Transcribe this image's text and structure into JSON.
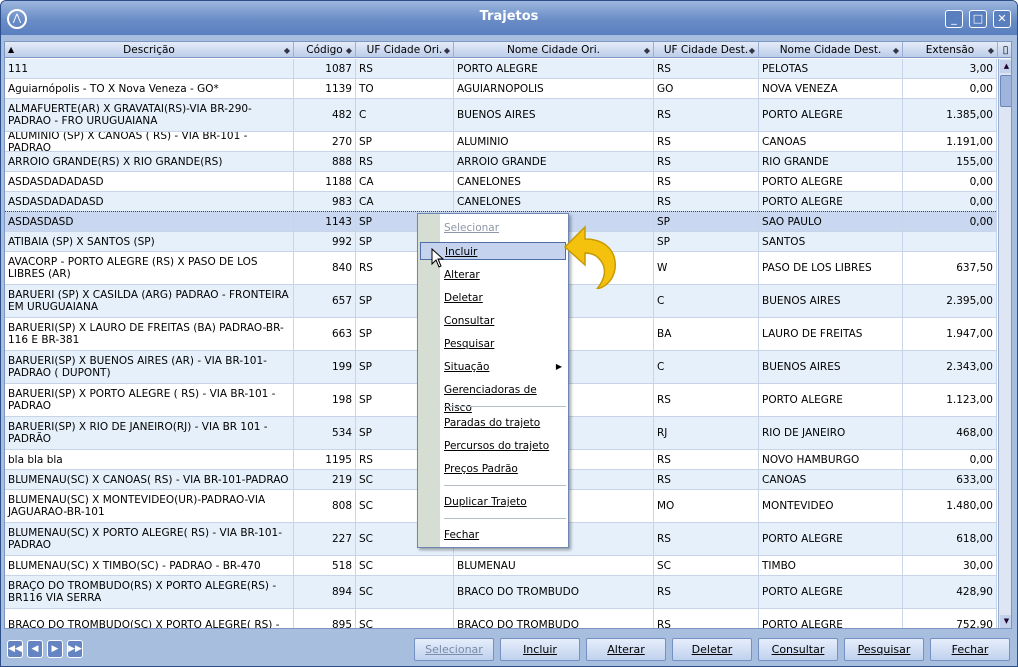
{
  "window": {
    "title": "Trajetos",
    "icons": {
      "logo": "app-logo-icon",
      "minimize": "minimize-icon",
      "maximize": "maximize-icon",
      "close": "close-icon"
    }
  },
  "grid": {
    "headers": [
      "Descrição",
      "Código",
      "UF Cidade Ori.",
      "Nome Cidade Ori.",
      "UF Cidade Dest.",
      "Nome Cidade Dest.",
      "Extensão"
    ],
    "rows": [
      {
        "desc": "111",
        "code": "1087",
        "uf_ori": "RS",
        "city_ori": "PORTO ALEGRE",
        "uf_dest": "RS",
        "city_dest": "PELOTAS",
        "ext": "3,00"
      },
      {
        "desc": "Aguiarnópolis - TO X Nova Veneza - GO*",
        "code": "1139",
        "uf_ori": "TO",
        "city_ori": "AGUIARNOPOLIS",
        "uf_dest": "GO",
        "city_dest": "NOVA VENEZA",
        "ext": "0,00"
      },
      {
        "desc": "ALMAFUERTE(AR) X GRAVATAI(RS)-VIA BR-290-PADRAO - FRO URUGUAIANA",
        "code": "482",
        "uf_ori": "C",
        "city_ori": "BUENOS AIRES",
        "uf_dest": "RS",
        "city_dest": "PORTO ALEGRE",
        "ext": "1.385,00"
      },
      {
        "desc": "ALUMINIO (SP) X CANOAS ( RS) - VIA BR-101 - PADRAO",
        "code": "270",
        "uf_ori": "SP",
        "city_ori": "ALUMINIO",
        "uf_dest": "RS",
        "city_dest": "CANOAS",
        "ext": "1.191,00"
      },
      {
        "desc": "ARROIO GRANDE(RS) X RIO GRANDE(RS)",
        "code": "888",
        "uf_ori": "RS",
        "city_ori": "ARROIO GRANDE",
        "uf_dest": "RS",
        "city_dest": "RIO GRANDE",
        "ext": "155,00"
      },
      {
        "desc": "ASDASDADADASD",
        "code": "1188",
        "uf_ori": "CA",
        "city_ori": "CANELONES",
        "uf_dest": "RS",
        "city_dest": "PORTO ALEGRE",
        "ext": "0,00"
      },
      {
        "desc": "ASDASDADADASD",
        "code": "983",
        "uf_ori": "CA",
        "city_ori": "CANELONES",
        "uf_dest": "RS",
        "city_dest": "PORTO ALEGRE",
        "ext": "0,00"
      },
      {
        "desc": "ASDASDASD",
        "code": "1143",
        "uf_ori": "SP",
        "city_ori": "",
        "uf_dest": "SP",
        "city_dest": "SAO PAULO",
        "ext": "0,00"
      },
      {
        "desc": "ATIBAIA (SP) X SANTOS (SP)",
        "code": "992",
        "uf_ori": "SP",
        "city_ori": "",
        "uf_dest": "SP",
        "city_dest": "SANTOS",
        "ext": ""
      },
      {
        "desc": "AVACORP - PORTO ALEGRE (RS) X PASO DE LOS LIBRES (AR)",
        "code": "840",
        "uf_ori": "RS",
        "city_ori": "",
        "uf_dest": "W",
        "city_dest": "PASO DE LOS LIBRES",
        "ext": "637,50"
      },
      {
        "desc": "BARUERI (SP) X CASILDA (ARG) PADRAO - FRONTEIRA EM URUGUAIANA",
        "code": "657",
        "uf_ori": "SP",
        "city_ori": "",
        "uf_dest": "C",
        "city_dest": "BUENOS AIRES",
        "ext": "2.395,00"
      },
      {
        "desc": "BARUERI(SP) X LAURO DE FREITAS (BA) PADRAO-BR-116 E BR-381",
        "code": "663",
        "uf_ori": "SP",
        "city_ori": "",
        "uf_dest": "BA",
        "city_dest": "LAURO DE FREITAS",
        "ext": "1.947,00"
      },
      {
        "desc": "BARUERI(SP) X BUENOS AIRES (AR) - VIA BR-101-PADRAO ( DUPONT)",
        "code": "199",
        "uf_ori": "SP",
        "city_ori": "",
        "uf_dest": "C",
        "city_dest": "BUENOS AIRES",
        "ext": "2.343,00"
      },
      {
        "desc": "BARUERI(SP) X PORTO ALEGRE ( RS) - VIA BR-101 - PADRAO",
        "code": "198",
        "uf_ori": "SP",
        "city_ori": "",
        "uf_dest": "RS",
        "city_dest": "PORTO ALEGRE",
        "ext": "1.123,00"
      },
      {
        "desc": "BARUERI(SP) X RIO DE JANEIRO(RJ) - VIA BR 101 - PADRÃO",
        "code": "534",
        "uf_ori": "SP",
        "city_ori": "",
        "uf_dest": "RJ",
        "city_dest": "RIO DE JANEIRO",
        "ext": "468,00"
      },
      {
        "desc": "bla bla bla",
        "code": "1195",
        "uf_ori": "RS",
        "city_ori": "",
        "uf_dest": "RS",
        "city_dest": "NOVO HAMBURGO",
        "ext": "0,00"
      },
      {
        "desc": "BLUMENAU(SC) X CANOAS( RS) - VIA BR-101-PADRAO",
        "code": "219",
        "uf_ori": "SC",
        "city_ori": "",
        "uf_dest": "RS",
        "city_dest": "CANOAS",
        "ext": "633,00"
      },
      {
        "desc": "BLUMENAU(SC) X MONTEVIDEO(UR)-PADRAO-VIA JAGUARAO-BR-101",
        "code": "808",
        "uf_ori": "SC",
        "city_ori": "",
        "uf_dest": "MO",
        "city_dest": "MONTEVIDEO",
        "ext": "1.480,00"
      },
      {
        "desc": "BLUMENAU(SC) X PORTO ALEGRE( RS) - VIA BR-101-PADRAO",
        "code": "227",
        "uf_ori": "SC",
        "city_ori": "",
        "uf_dest": "RS",
        "city_dest": "PORTO ALEGRE",
        "ext": "618,00"
      },
      {
        "desc": "BLUMENAU(SC) X TIMBO(SC) - PADRAO - BR-470",
        "code": "518",
        "uf_ori": "SC",
        "city_ori": "BLUMENAU",
        "uf_dest": "SC",
        "city_dest": "TIMBO",
        "ext": "30,00"
      },
      {
        "desc": "BRAÇO DO TROMBUDO(RS) X PORTO ALEGRE(RS) - BR116 VIA SERRA",
        "code": "894",
        "uf_ori": "SC",
        "city_ori": "BRACO DO TROMBUDO",
        "uf_dest": "RS",
        "city_dest": "PORTO ALEGRE",
        "ext": "428,90"
      },
      {
        "desc": "BRAÇO DO TROMBUDO(SC) X PORTO ALEGRE( RS) -",
        "code": "895",
        "uf_ori": "SC",
        "city_ori": "BRACO DO TROMBUDO",
        "uf_dest": "RS",
        "city_dest": "PORTO ALEGRE",
        "ext": "752,90"
      }
    ]
  },
  "context_menu": {
    "items": [
      "Selecionar",
      "Incluir",
      "Alterar",
      "Deletar",
      "Consultar",
      "Pesquisar",
      "Situação",
      "Gerenciadoras de Risco",
      "Paradas do trajeto",
      "Percursos do trajeto",
      "Preços Padrão",
      "Duplicar Trajeto",
      "Fechar"
    ],
    "disabled": [
      "Selecionar"
    ],
    "highlighted": "Incluir"
  },
  "toolbar": {
    "buttons": [
      "Selecionar",
      "Incluir",
      "Alterar",
      "Deletar",
      "Consultar",
      "Pesquisar",
      "Fechar"
    ],
    "nav_icons": [
      "first-page-icon",
      "prev-page-icon",
      "next-page-icon",
      "last-page-icon"
    ]
  },
  "colors": {
    "title_bar": "#6a8dc7",
    "row_alt": "#e6f0fb",
    "selected_row": "#c9d8f0",
    "annotation_arrow": "#f4c20d"
  }
}
